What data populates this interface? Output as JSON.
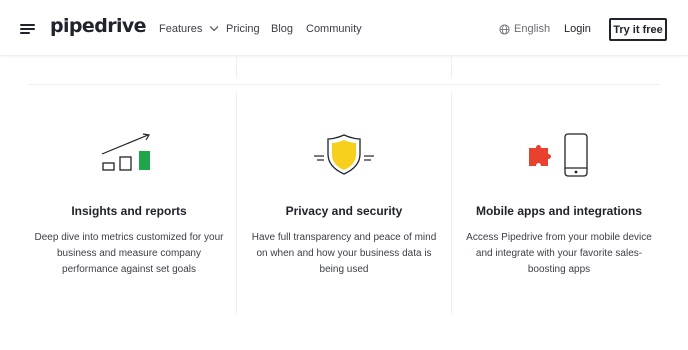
{
  "header": {
    "logo": "pipedrive",
    "nav": {
      "features": "Features",
      "pricing": "Pricing",
      "blog": "Blog",
      "community": "Community"
    },
    "language": "English",
    "login": "Login",
    "cta": "Try it free"
  },
  "features": [
    {
      "icon": "bar-chart-growth-icon",
      "title": "Insights and reports",
      "description": "Deep dive into metrics customized for your business and measure company performance against set goals"
    },
    {
      "icon": "shield-icon",
      "title": "Privacy and security",
      "description": "Have full transparency and peace of mind on when and how your business data is being used"
    },
    {
      "icon": "mobile-puzzle-icon",
      "title": "Mobile apps and integrations",
      "description": "Access Pipedrive from your mobile device and integrate with your favorite sales-boosting apps"
    }
  ],
  "colors": {
    "text": "#21232c",
    "green": "#1fa54a",
    "yellow": "#f7cf1d",
    "red": "#e8412e",
    "divider": "#eeeff2"
  }
}
